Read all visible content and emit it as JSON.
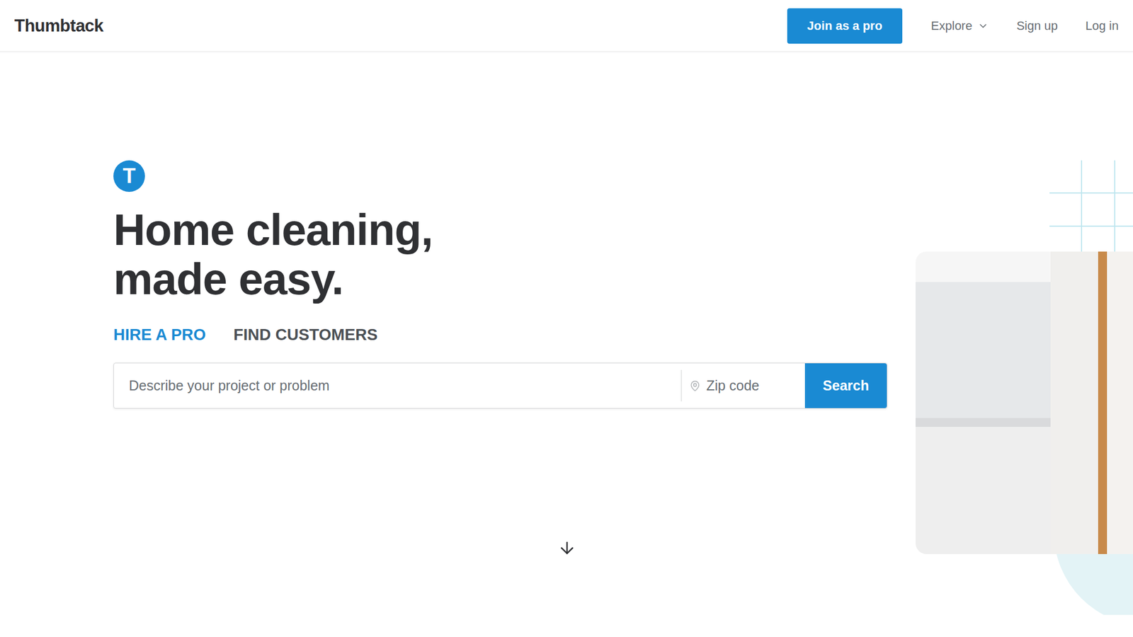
{
  "header": {
    "logo": "Thumbtack",
    "primary_button": "Join as a pro",
    "nav": [
      {
        "label": "Explore",
        "kind": "dropdown"
      },
      {
        "label": "Sign up",
        "kind": "link"
      },
      {
        "label": "Log in",
        "kind": "link"
      }
    ]
  },
  "hero": {
    "brand_mark": "T",
    "title": [
      "Home cleaning,",
      "made easy."
    ],
    "tabs": [
      {
        "label": "HIRE A PRO",
        "selected": true
      },
      {
        "label": "FIND CUSTOMERS",
        "selected": false
      }
    ],
    "search": {
      "placeholder": "Describe your project or problem",
      "zip_placeholder": "Zip code",
      "button": "Search"
    }
  }
}
